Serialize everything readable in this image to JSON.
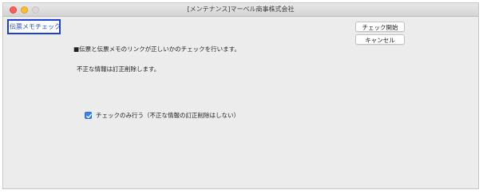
{
  "window": {
    "title": "[メンテナンス]マーベル商事株式会社"
  },
  "screen_label": "伝票メモチェック",
  "buttons": {
    "start": "チェック開始",
    "cancel": "キャンセル"
  },
  "messages": {
    "line1": "■伝票と伝票メモのリンクが正しいかのチェックを行います。",
    "line2": "不正な情報は訂正削除します。"
  },
  "option": {
    "label": "チェックのみ行う（不正な情報の訂正削除はしない）",
    "checked": true
  },
  "colors": {
    "accent": "#3b7ff0",
    "label_border": "#1f3fd0"
  }
}
